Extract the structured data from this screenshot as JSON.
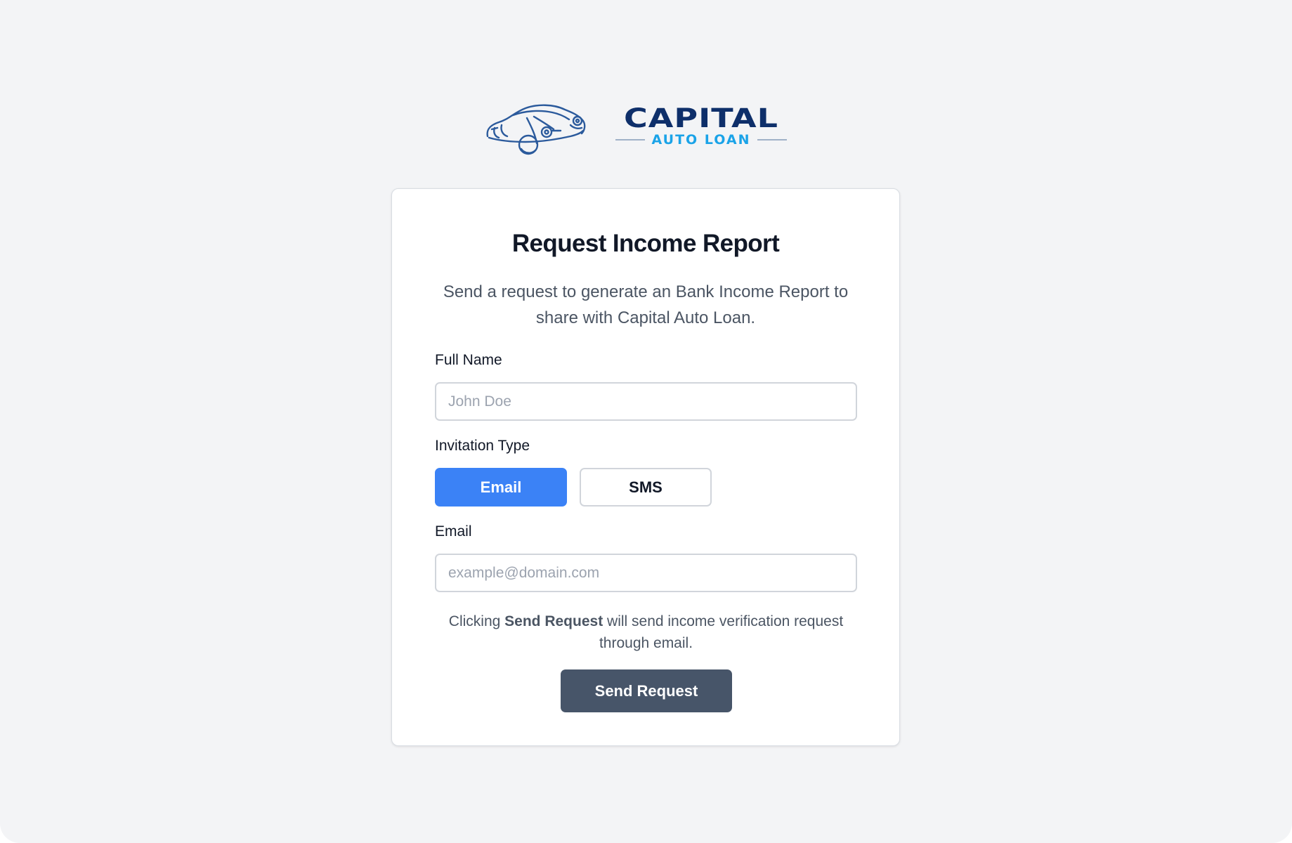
{
  "logo": {
    "brand": "CAPITAL",
    "subtext": "AUTO LOAN",
    "icon": "car-logo-icon"
  },
  "form": {
    "title": "Request Income Report",
    "subtitle": "Send a request to generate an Bank Income Report to share with Capital Auto Loan.",
    "full_name": {
      "label": "Full Name",
      "placeholder": "John Doe",
      "value": ""
    },
    "invitation_type": {
      "label": "Invitation Type",
      "options": [
        "Email",
        "SMS"
      ],
      "selected": "Email"
    },
    "email": {
      "label": "Email",
      "placeholder": "example@domain.com",
      "value": ""
    },
    "note": {
      "prefix": "Clicking ",
      "emphasis": "Send Request",
      "suffix": " will send income verification request through email."
    },
    "submit_label": "Send Request"
  },
  "colors": {
    "page_background": "#f3f4f6",
    "primary": "#3b82f6",
    "submit": "#475569",
    "brand_navy": "#0e2f6a",
    "brand_sky": "#1aa3e8"
  }
}
